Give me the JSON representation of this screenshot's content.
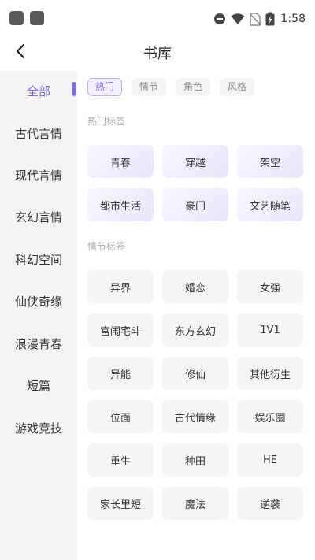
{
  "status_bar": {
    "time": "1:58",
    "icons": [
      "app-square-icon",
      "app-square-icon",
      "do-not-disturb-icon",
      "wifi-icon",
      "no-sim-icon",
      "battery-charging-icon"
    ]
  },
  "header": {
    "title": "书库",
    "back_icon": "chevron-left-icon"
  },
  "sidebar": {
    "items": [
      {
        "label": "全部",
        "active": true
      },
      {
        "label": "古代言情"
      },
      {
        "label": "现代言情"
      },
      {
        "label": "玄幻言情"
      },
      {
        "label": "科幻空间"
      },
      {
        "label": "仙侠奇缘"
      },
      {
        "label": "浪漫青春"
      },
      {
        "label": "短篇"
      },
      {
        "label": "游戏竞技"
      }
    ],
    "accent_color": "#7b6cf6"
  },
  "tabs": [
    {
      "label": "热门",
      "active": true
    },
    {
      "label": "情节"
    },
    {
      "label": "角色"
    },
    {
      "label": "风格"
    }
  ],
  "hot_section": {
    "title": "热门标签",
    "tags": [
      "青春",
      "穿越",
      "架空",
      "都市生活",
      "豪门",
      "文艺随笔"
    ]
  },
  "plot_section": {
    "title": "情节标签",
    "tags": [
      "异界",
      "婚恋",
      "女强",
      "宫闱宅斗",
      "东方玄幻",
      "1V1",
      "异能",
      "修仙",
      "其他衍生",
      "位面",
      "古代情缘",
      "娱乐圈",
      "重生",
      "种田",
      "HE",
      "家长里短",
      "魔法",
      "逆袭"
    ]
  }
}
